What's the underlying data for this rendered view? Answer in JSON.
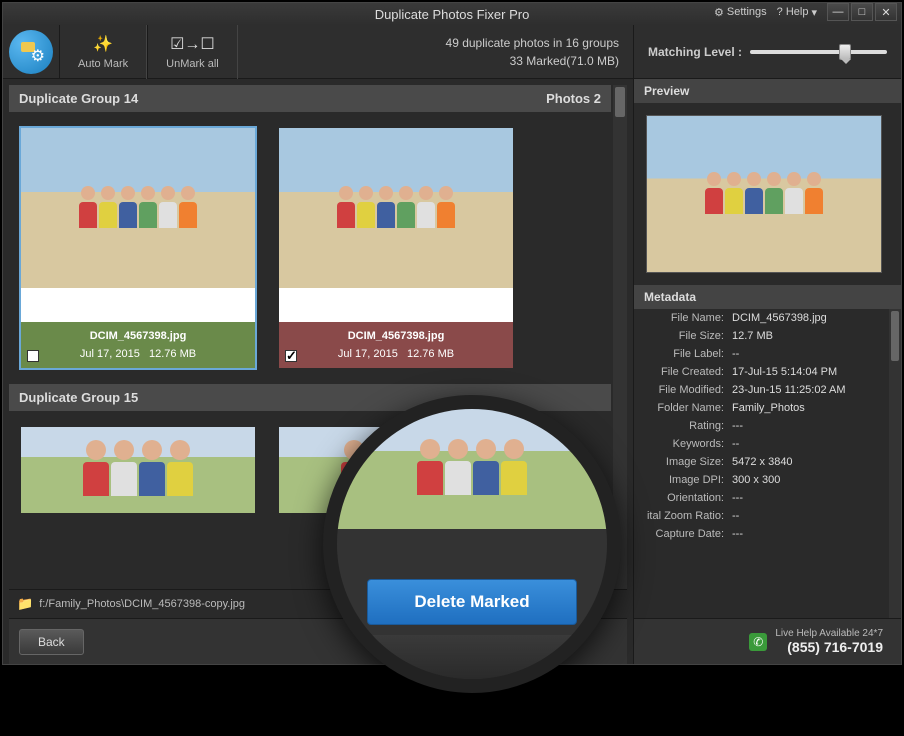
{
  "titlebar": {
    "title": "Duplicate Photos Fixer Pro",
    "settings": "Settings",
    "help": "? Help"
  },
  "toolbar": {
    "automark": "Auto Mark",
    "unmarkall": "UnMark all",
    "stats_line1": "49 duplicate photos in 16 groups",
    "stats_line2": "33 Marked(71.0 MB)",
    "matching_level": "Matching Level :"
  },
  "groups": [
    {
      "title": "Duplicate Group 14",
      "count_label": "Photos 2",
      "photos": [
        {
          "filename": "DCIM_4567398.jpg",
          "date": "Jul 17, 2015",
          "size": "12.76 MB",
          "checked": false,
          "color": "green"
        },
        {
          "filename": "DCIM_4567398.jpg",
          "date": "Jul 17, 2015",
          "size": "12.76 MB",
          "checked": true,
          "color": "red"
        }
      ]
    },
    {
      "title": "Duplicate Group 15"
    }
  ],
  "pathbar": {
    "path": "f:/Family_Photos\\DCIM_4567398-copy.jpg"
  },
  "preview": {
    "label": "Preview"
  },
  "metadata": {
    "label": "Metadata",
    "rows": [
      {
        "key": "File Name:",
        "val": "DCIM_4567398.jpg"
      },
      {
        "key": "File Size:",
        "val": "12.7 MB"
      },
      {
        "key": "File Label:",
        "val": "--"
      },
      {
        "key": "File Created:",
        "val": "17-Jul-15 5:14:04 PM"
      },
      {
        "key": "File Modified:",
        "val": "23-Jun-15 11:25:02 AM"
      },
      {
        "key": "Folder Name:",
        "val": "Family_Photos"
      },
      {
        "key": "Rating:",
        "val": "---"
      },
      {
        "key": "Keywords:",
        "val": "--"
      },
      {
        "key": "Image Size:",
        "val": "5472 x 3840"
      },
      {
        "key": "Image DPI:",
        "val": "300 x 300"
      },
      {
        "key": "Orientation:",
        "val": "---"
      },
      {
        "key": "ital Zoom Ratio:",
        "val": "--"
      },
      {
        "key": "Capture Date:",
        "val": "---"
      }
    ]
  },
  "bottom": {
    "back": "Back",
    "help_text": "Live Help Available 24*7",
    "phone": "(855) 716-7019"
  },
  "magnifier": {
    "delete": "Delete Marked"
  }
}
